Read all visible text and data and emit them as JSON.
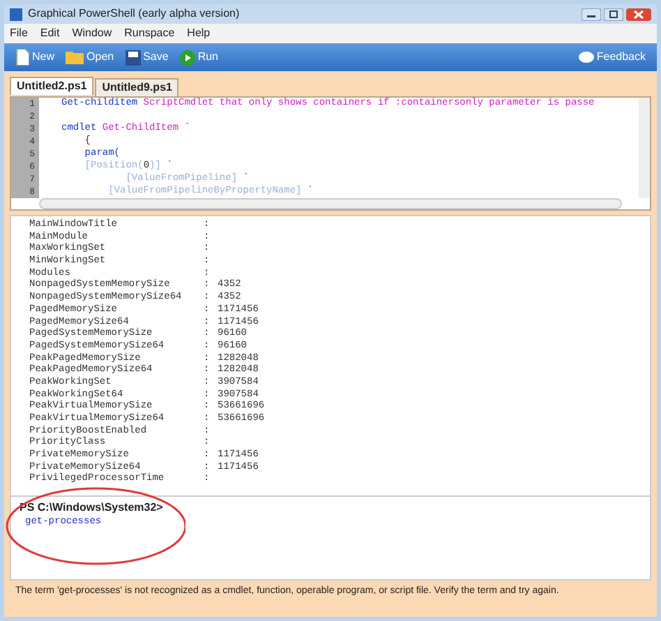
{
  "window": {
    "title": "Graphical PowerShell (early alpha version)"
  },
  "menu": [
    "File",
    "Edit",
    "Window",
    "Runspace",
    "Help"
  ],
  "toolbar": {
    "buttons": [
      {
        "kind": "new",
        "label": "New"
      },
      {
        "kind": "open",
        "label": "Open"
      },
      {
        "kind": "save",
        "label": "Save"
      },
      {
        "kind": "run",
        "label": "Run"
      }
    ],
    "feedback": "Feedback"
  },
  "tabs": [
    {
      "label": "Untitled2.ps1",
      "selected": true
    },
    {
      "label": "Untitled9.ps1",
      "selected": false
    }
  ],
  "editor": {
    "lines": [
      {
        "number": "1",
        "tokens": [
          {
            "kind": "command",
            "text": "Get-childitem"
          },
          {
            "kind": "string",
            "text": " ScriptCmdlet that only shows containers if :containersonly parameter is passe"
          }
        ]
      },
      {
        "number": "2"
      },
      {
        "number": "3",
        "tokens": [
          {
            "kind": "command",
            "text": "cmdlet"
          },
          {
            "kind": "string",
            "text": " Get-ChildItem"
          },
          {
            "kind": "plain",
            "text": " `"
          }
        ]
      },
      {
        "number": "4",
        "tokens": [
          {
            "kind": "plain",
            "text": "    {"
          }
        ]
      },
      {
        "number": "5",
        "tokens": [
          {
            "kind": "command",
            "text": "    param("
          }
        ]
      },
      {
        "number": "6",
        "tokens": [
          {
            "kind": "attribute",
            "text": "    [Position("
          },
          {
            "kind": "plain",
            "text": "0"
          },
          {
            "kind": "attribute",
            "text": ")]"
          },
          {
            "kind": "plain",
            "text": " `"
          }
        ]
      },
      {
        "number": "7",
        "tokens": [
          {
            "kind": "attribute",
            "text": "           [ValueFromPipeline]"
          },
          {
            "kind": "plain",
            "text": " `"
          }
        ]
      },
      {
        "number": "8",
        "tokens": [
          {
            "kind": "attribute",
            "text": "        [ValueFromPipelineByPropertyName]"
          },
          {
            "kind": "plain",
            "text": " `"
          }
        ]
      }
    ]
  },
  "output": {
    "separator": ":",
    "rows": [
      {
        "name": "MainWindowTitle"
      },
      {
        "name": "MainModule"
      },
      {
        "name": "MaxWorkingSet"
      },
      {
        "name": "MinWorkingSet"
      },
      {
        "name": "Modules"
      },
      {
        "name": "NonpagedSystemMemorySize",
        "value": "4352"
      },
      {
        "name": "NonpagedSystemMemorySize64",
        "value": "4352"
      },
      {
        "name": "PagedMemorySize",
        "value": "1171456"
      },
      {
        "name": "PagedMemorySize64",
        "value": "1171456"
      },
      {
        "name": "PagedSystemMemorySize",
        "value": "96160"
      },
      {
        "name": "PagedSystemMemorySize64",
        "value": "96160"
      },
      {
        "name": "PeakPagedMemorySize",
        "value": "1282048"
      },
      {
        "name": "PeakPagedMemorySize64",
        "value": "1282048"
      },
      {
        "name": "PeakWorkingSet",
        "value": "3907584"
      },
      {
        "name": "PeakWorkingSet64",
        "value": "3907584"
      },
      {
        "name": "PeakVirtualMemorySize",
        "value": "53661696"
      },
      {
        "name": "PeakVirtualMemorySize64",
        "value": "53661696"
      },
      {
        "name": "PriorityBoostEnabled"
      },
      {
        "name": "PriorityClass"
      },
      {
        "name": "PrivateMemorySize",
        "value": "1171456"
      },
      {
        "name": "PrivateMemorySize64",
        "value": "1171456"
      },
      {
        "name": "PrivilegedProcessorTime"
      }
    ]
  },
  "console": {
    "prompt": "PS C:\\Windows\\System32>",
    "command": "get-processes"
  },
  "status_bar": {
    "message": "The term 'get-processes' is not recognized as a cmdlet, function, operable program, or script file. Verify the term and try again."
  }
}
